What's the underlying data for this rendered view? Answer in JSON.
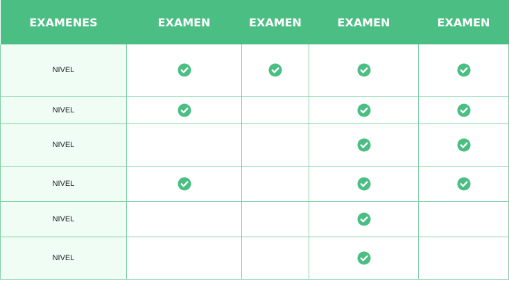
{
  "header": {
    "columns": [
      "EXAMENES",
      "EXAMEN",
      "EXAMEN",
      "EXAMEN",
      "EXAMEN"
    ]
  },
  "colors": {
    "header_bg": "#4bbf83",
    "check": "#4bbf83",
    "label_bg": "#effdf5",
    "border": "#7fcfa6"
  },
  "rows": [
    {
      "label": "NIVEL",
      "checks": [
        true,
        true,
        true,
        true
      ]
    },
    {
      "label": "NIVEL",
      "checks": [
        true,
        false,
        true,
        true
      ]
    },
    {
      "label": "NIVEL",
      "checks": [
        false,
        false,
        true,
        true
      ]
    },
    {
      "label": "NIVEL",
      "checks": [
        true,
        false,
        true,
        true
      ]
    },
    {
      "label": "NIVEL",
      "checks": [
        false,
        false,
        true,
        false
      ]
    },
    {
      "label": "NIVEL",
      "checks": [
        false,
        false,
        true,
        false
      ]
    }
  ],
  "icons": {
    "check": "check-circle-icon"
  }
}
